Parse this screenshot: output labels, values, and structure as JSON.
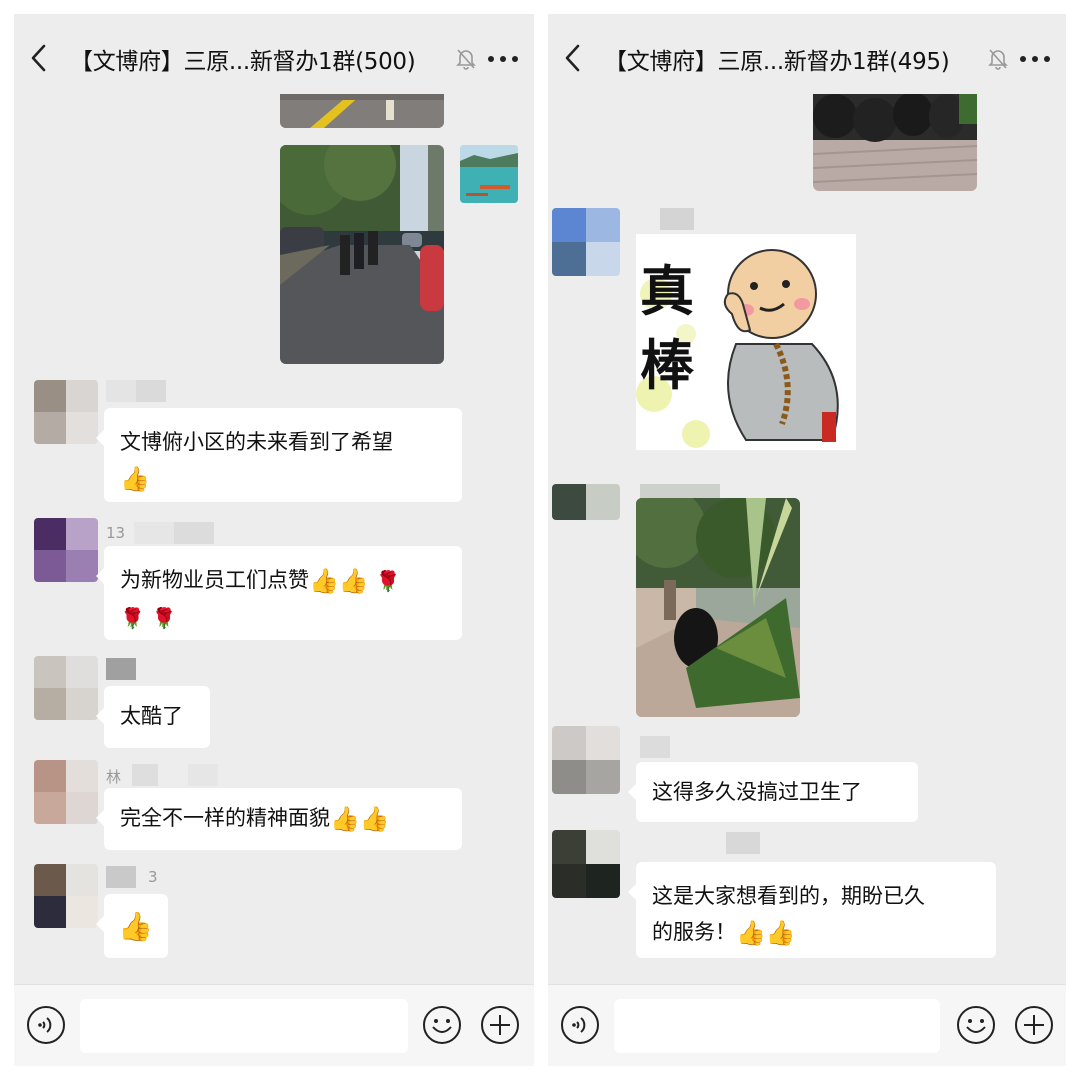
{
  "left_chat": {
    "title": "【文博府】三原...新督办1群(500)",
    "messages": [
      {
        "sender_label": "",
        "text": "文博俯小区的未来看到了希望",
        "emoji": "👍"
      },
      {
        "sender_label": "13",
        "text": "为新物业员工们点赞",
        "emoji": "👍👍"
      },
      {
        "sender_label": "",
        "text": "太酷了"
      },
      {
        "sender_label": "林",
        "text": "完全不一样的精神面貌",
        "emoji": "👍👍"
      },
      {
        "sender_label": "3",
        "text": "",
        "emoji": "👍"
      }
    ]
  },
  "right_chat": {
    "title": "【文博府】三原...新督办1群(495)",
    "sticker_text": "真棒",
    "messages": [
      {
        "text": "这得多久没搞过卫生了"
      },
      {
        "text_line1": "这是大家想看到的，期盼已久",
        "text_line2": "的服务！",
        "emoji": "👍👍"
      }
    ]
  },
  "icons": {
    "back": "back-arrow-icon",
    "mute": "mute-bell-icon",
    "more": "more-dots-icon",
    "voice": "voice-icon",
    "emoji": "emoji-icon",
    "plus": "plus-icon"
  },
  "colors": {
    "chat_bg": "#ededed",
    "bubble_bg": "#ffffff",
    "input_bg": "#f6f6f6"
  }
}
